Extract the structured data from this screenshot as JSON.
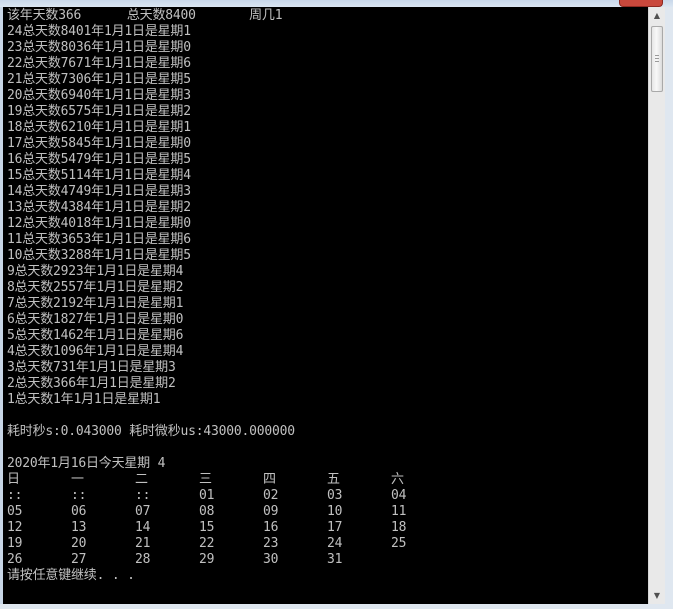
{
  "colors": {
    "console_bg": "#000000",
    "console_text": "#c0c0c0",
    "close_button": "#c9483c",
    "frame": "#dfe7f0"
  },
  "icons": {
    "close": "close-icon",
    "scroll_up": "arrow-up-icon",
    "scroll_down": "arrow-down-icon"
  },
  "scrollbar": {
    "up_glyph": "▲",
    "down_glyph": "▼"
  },
  "console": {
    "header_line": "该年天数366      总天数8400       周几1",
    "lines": [
      "24总天数8401年1月1日是星期1",
      "23总天数8036年1月1日是星期0",
      "22总天数7671年1月1日是星期6",
      "21总天数7306年1月1日是星期5",
      "20总天数6940年1月1日是星期3",
      "19总天数6575年1月1日是星期2",
      "18总天数6210年1月1日是星期1",
      "17总天数5845年1月1日是星期0",
      "16总天数5479年1月1日是星期5",
      "15总天数5114年1月1日是星期4",
      "14总天数4749年1月1日是星期3",
      "13总天数4384年1月1日是星期2",
      "12总天数4018年1月1日是星期0",
      "11总天数3653年1月1日是星期6",
      "10总天数3288年1月1日是星期5",
      "9总天数2923年1月1日是星期4",
      "8总天数2557年1月1日是星期2",
      "7总天数2192年1月1日是星期1",
      "6总天数1827年1月1日是星期0",
      "5总天数1462年1月1日是星期6",
      "4总天数1096年1月1日是星期4",
      "3总天数731年1月1日是星期3",
      "2总天数366年1月1日是星期2",
      "1总天数1年1月1日是星期1"
    ],
    "timing_line": "耗时秒s:0.043000 耗时微秒us:43000.000000",
    "date_line": "2020年1月16日今天星期 4",
    "calendar": {
      "headers": [
        "日",
        "一",
        "二",
        "三",
        "四",
        "五",
        "六"
      ],
      "rows": [
        [
          "::",
          "::",
          "::",
          "01",
          "02",
          "03",
          "04"
        ],
        [
          "05",
          "06",
          "07",
          "08",
          "09",
          "10",
          "11"
        ],
        [
          "12",
          "13",
          "14",
          "15",
          "16",
          "17",
          "18"
        ],
        [
          "19",
          "20",
          "21",
          "22",
          "23",
          "24",
          "25"
        ],
        [
          "26",
          "27",
          "28",
          "29",
          "30",
          "31",
          ""
        ]
      ]
    },
    "prompt_line": "请按任意键继续. . ."
  }
}
